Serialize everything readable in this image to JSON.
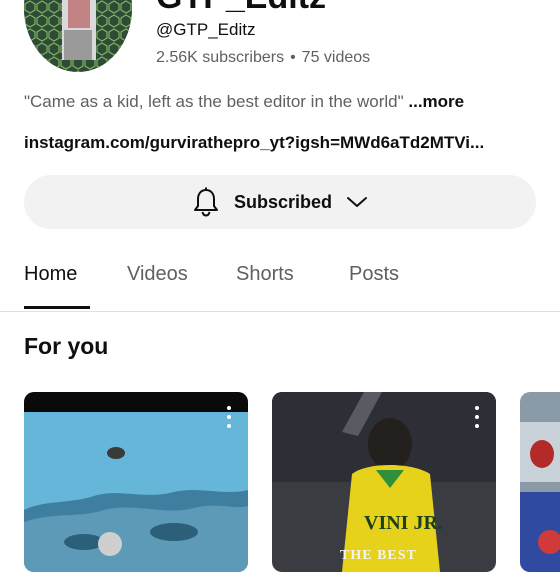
{
  "channel": {
    "title": "GTP_Editz",
    "handle": "@GTP_Editz",
    "subscribers": "2.56K subscribers",
    "separator": "•",
    "videos": "75 videos",
    "description": "\"Came as a kid, left as the best editor in the world\"",
    "more_label": "...more",
    "link": "instagram.com/gurvirathepro_yt?igsh=MWd6aTd2MTVi..."
  },
  "subscribe_button": {
    "label": "Subscribed",
    "icon": "bell-icon",
    "dropdown_icon": "chevron-down-icon"
  },
  "tabs": [
    {
      "label": "Home",
      "active": true
    },
    {
      "label": "Videos",
      "active": false
    },
    {
      "label": "Shorts",
      "active": false
    },
    {
      "label": "Posts",
      "active": false
    }
  ],
  "section": {
    "title": "For you"
  },
  "cards": [
    {
      "overlay_text": ""
    },
    {
      "overlay_text": "VINI JR.",
      "overlay_text_2": "THE BEST"
    },
    {
      "overlay_text": ""
    }
  ],
  "colors": {
    "text_primary": "#0f0f0f",
    "text_secondary": "#606060",
    "button_bg": "#f2f2f2",
    "divider": "#e0e0e0"
  }
}
